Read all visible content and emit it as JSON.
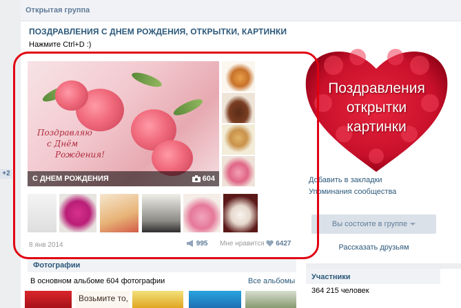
{
  "left_badge": "+2",
  "group_header": "Открытая группа",
  "page_title": "ПОЗДРАВЛЕНИЯ С ДНЕМ РОЖДЕНИЯ, ОТКРЫТКИ, КАРТИНКИ",
  "status": "Нажмите Ctrl+D :)",
  "album": {
    "card_text": [
      "Поздравляю",
      "с Днём",
      "Рождения!"
    ],
    "caption_title": "С ДНЕМ РОЖДЕНИЯ",
    "photo_count": "604",
    "date": "8 янв 2014",
    "shares": "995",
    "likes_label": "Мне нравится",
    "likes": "6427"
  },
  "photos": {
    "header": "Фотографии",
    "subtitle": "В основном альбоме 604 фотографии",
    "all_link": "Все альбомы",
    "thumb2_text": "Возьмите то,"
  },
  "avatar_text": [
    "Поздравления",
    "открытки",
    "картинки"
  ],
  "links": {
    "bookmarks": "Добавить в закладки",
    "mentions": "Упоминания сообщества"
  },
  "member_button": "Вы состоите в группе",
  "tell_friends": "Рассказать друзьям",
  "participants": {
    "header": "Участники",
    "count": "364 215 человек"
  },
  "colors": {
    "link": "#2b587a",
    "highlight": "#e00011",
    "heart": "#d3102a"
  }
}
